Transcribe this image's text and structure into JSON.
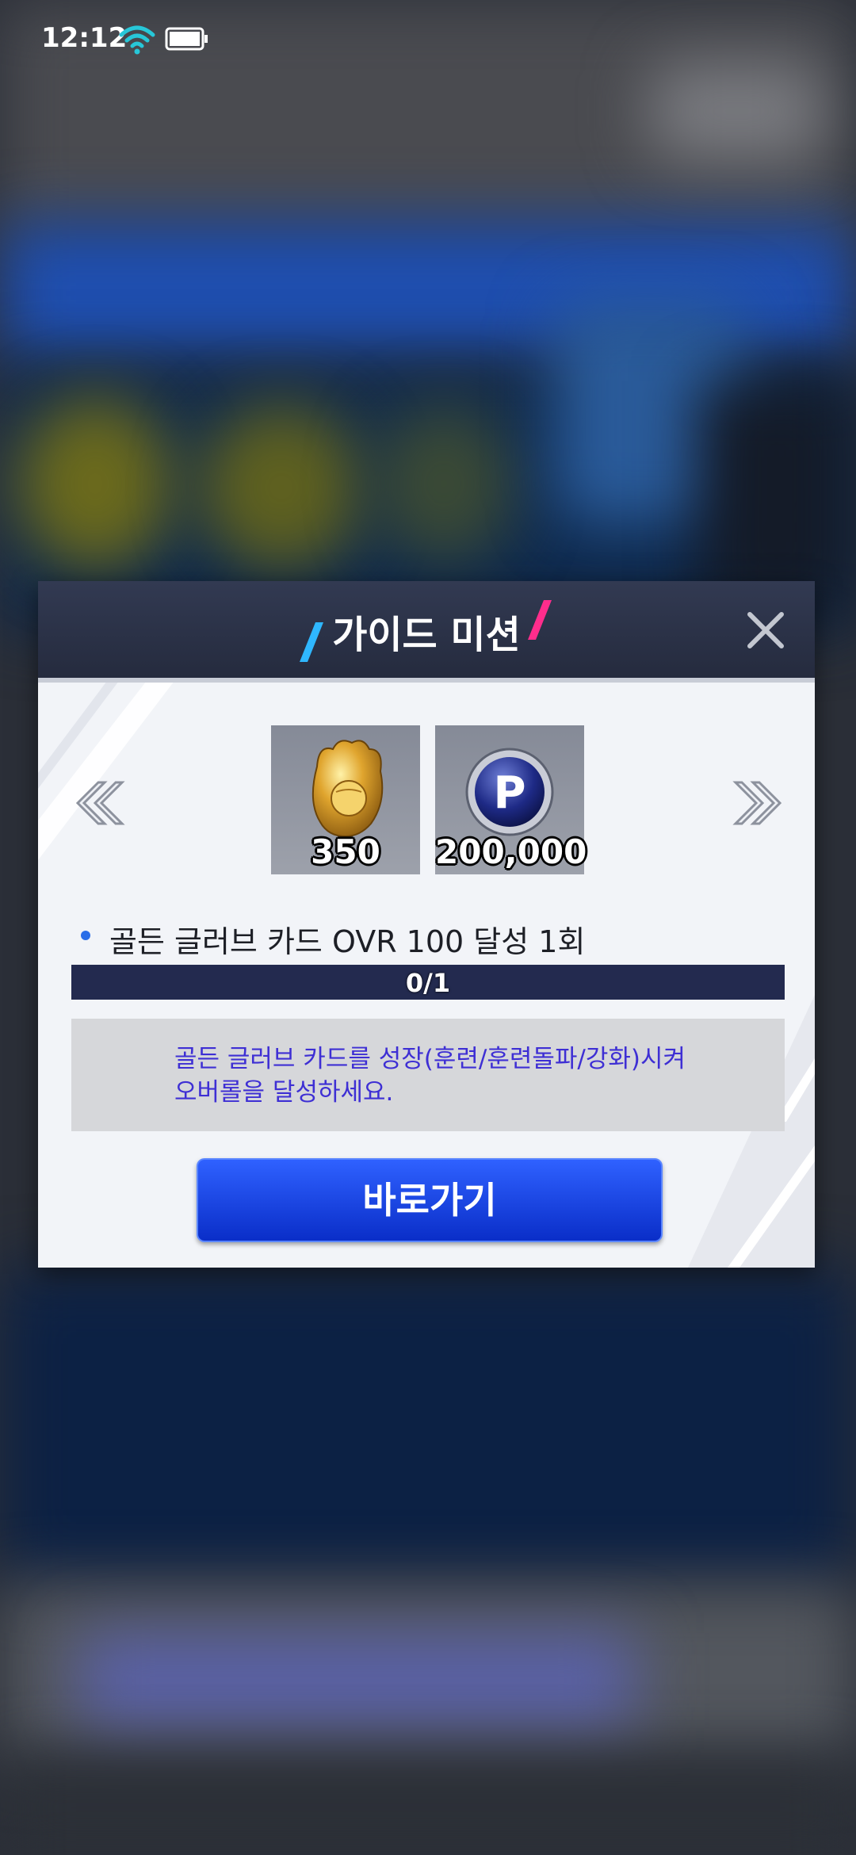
{
  "status_bar": {
    "time": "12:12"
  },
  "dialog": {
    "title": "가이드 미션",
    "rewards": [
      {
        "icon": "golden-glove-icon",
        "amount": "350"
      },
      {
        "icon": "p-coin-icon",
        "amount": "200,000"
      }
    ],
    "mission_text": "골든 글러브 카드 OVR 100 달성 1회",
    "progress": {
      "text": "0/1",
      "value": 0
    },
    "description_line1": "골든 글러브 카드를 성장(훈련/훈련돌파/강화)시켜",
    "description_line2": "오버롤을 달성하세요.",
    "go_button": "바로가기"
  }
}
